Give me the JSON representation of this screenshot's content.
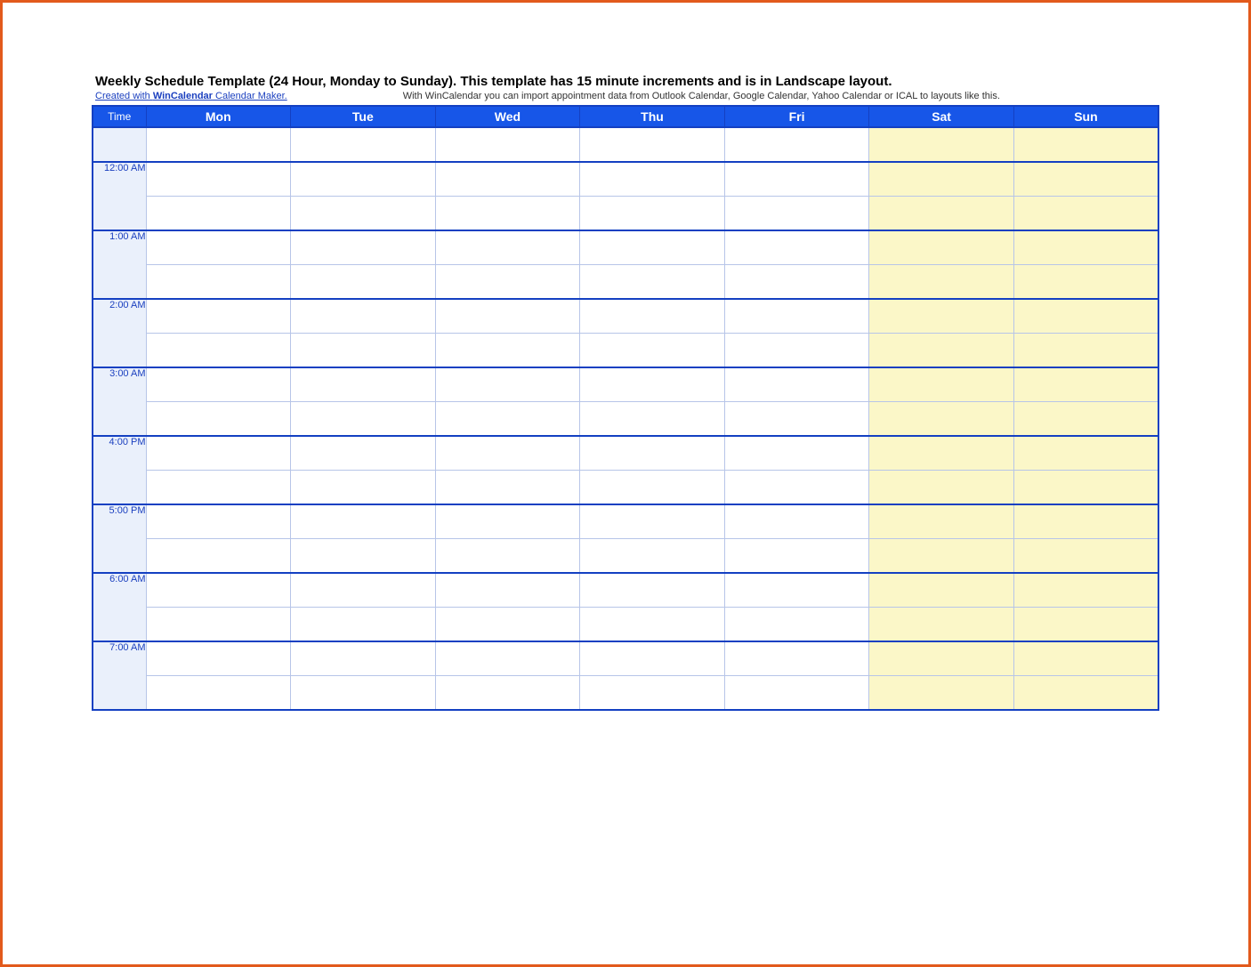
{
  "title": "Weekly Schedule Template (24 Hour, Monday to Sunday).  This template has 15 minute increments and is in Landscape layout.",
  "credit": {
    "prefix": "Created with ",
    "brand": "WinCalendar",
    "suffix": " Calendar Maker."
  },
  "subnote": "With WinCalendar you can import appointment data from Outlook Calendar, Google Calendar, Yahoo Calendar or ICAL to layouts like this.",
  "header": {
    "time": "Time",
    "days": [
      "Mon",
      "Tue",
      "Wed",
      "Thu",
      "Fri",
      "Sat",
      "Sun"
    ]
  },
  "weekend_indices": [
    5,
    6
  ],
  "time_slots": [
    "12:00 AM",
    "1:00 AM",
    "2:00 AM",
    "3:00 AM",
    "4:00 PM",
    "5:00 PM",
    "6:00 AM",
    "7:00 AM"
  ]
}
